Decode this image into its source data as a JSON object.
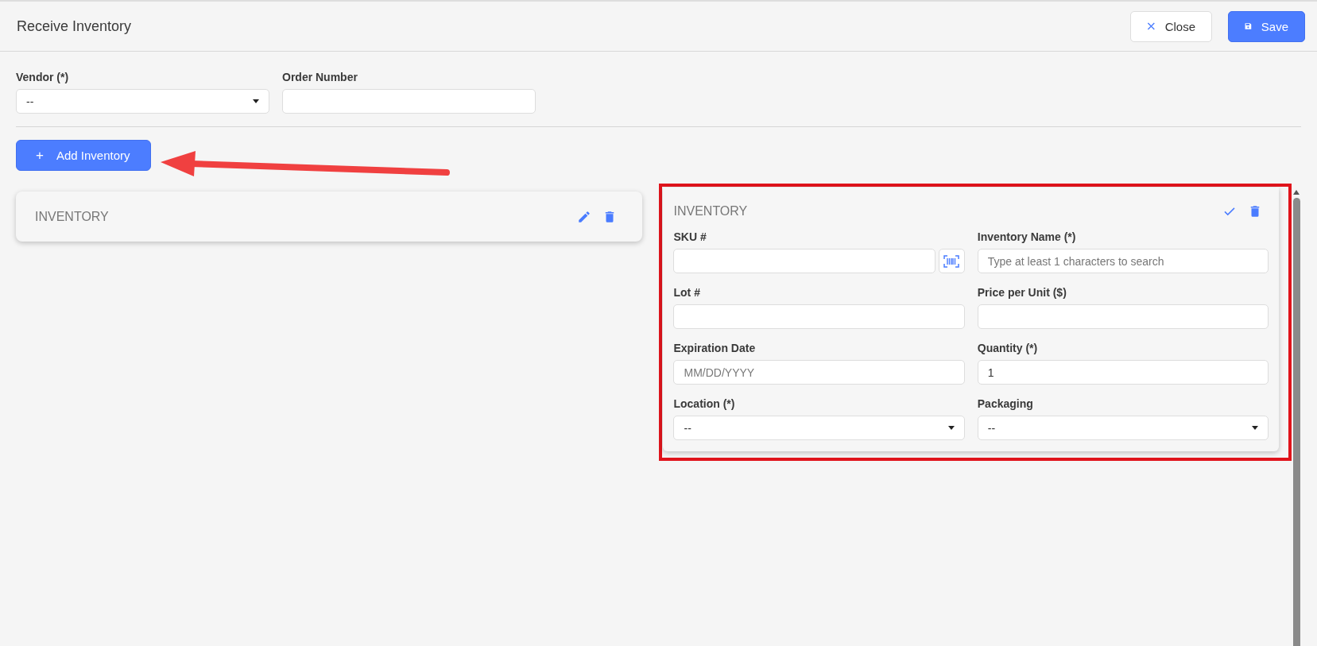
{
  "header": {
    "title": "Receive Inventory",
    "buttons": [
      {
        "label": "Close",
        "kind": "secondary"
      },
      {
        "label": "Save",
        "kind": "primary"
      }
    ]
  },
  "order_fields": [
    {
      "label": "Vendor (*)",
      "kind": "select",
      "value": "--"
    },
    {
      "label": "Order Number",
      "kind": "text"
    }
  ],
  "add_button": {
    "label": "Add Inventory",
    "icon": "+"
  },
  "collapsed_card": {
    "title": "INVENTORY"
  },
  "edit_card": {
    "title": "INVENTORY",
    "fields": [
      {
        "label": "SKU #",
        "kind": "scan"
      },
      {
        "label": "Inventory Name (*)",
        "kind": "text",
        "placeholder": "Type at least 1 characters to search"
      },
      {
        "label": "Lot #",
        "kind": "text"
      },
      {
        "label": "Price per Unit ($)",
        "kind": "text"
      },
      {
        "label": "Expiration Date",
        "kind": "text",
        "placeholder": "MM/DD/YYYY"
      },
      {
        "label": "Quantity (*)",
        "kind": "text",
        "value": "1"
      },
      {
        "label": "Location (*)",
        "kind": "select",
        "value": "--"
      },
      {
        "label": "Packaging",
        "kind": "select",
        "value": "--"
      }
    ]
  }
}
